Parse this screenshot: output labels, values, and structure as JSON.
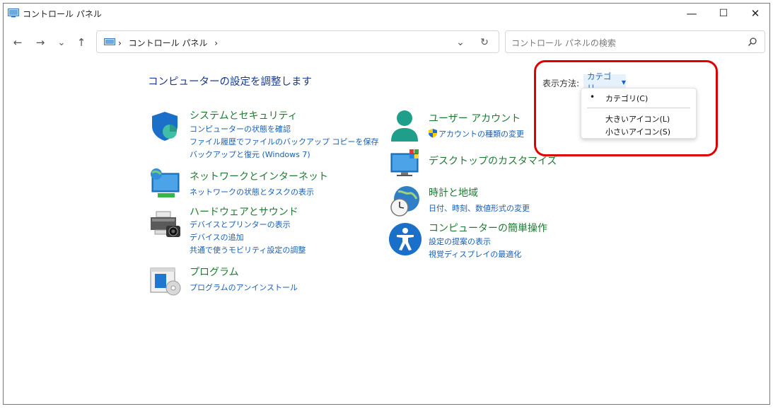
{
  "window": {
    "title": "コントロール パネル",
    "minimize": "—",
    "maximize": "☐",
    "close": "✕"
  },
  "nav": {
    "back": "←",
    "forward": "→",
    "recent": "⌄",
    "up": "↑",
    "breadcrumb_sep1": "›",
    "breadcrumb_item": "コントロール パネル",
    "breadcrumb_sep2": "›",
    "dropdown": "⌄",
    "refresh": "↻",
    "search_placeholder": "コントロール パネルの検索"
  },
  "main": {
    "heading": "コンピューターの設定を調整します",
    "view_label": "表示方法:",
    "view_value": "カテゴリ",
    "view_arrow": "▼"
  },
  "menu": {
    "items": [
      {
        "label": "カテゴリ(C)",
        "selected": true,
        "marker": "•"
      },
      {
        "label": "大きいアイコン(L)",
        "selected": false
      },
      {
        "label": "小さいアイコン(S)",
        "selected": false
      }
    ]
  },
  "left_categories": [
    {
      "title": "システムとセキュリティ",
      "icon": "shield-icon",
      "links": [
        "コンピューターの状態を確認",
        "ファイル履歴でファイルのバックアップ コピーを保存",
        "バックアップと復元 (Windows 7)"
      ]
    },
    {
      "title": "ネットワークとインターネット",
      "icon": "network-icon",
      "links": [
        "ネットワークの状態とタスクの表示"
      ]
    },
    {
      "title": "ハードウェアとサウンド",
      "icon": "printer-icon",
      "links": [
        "デバイスとプリンターの表示",
        "デバイスの追加",
        "共通で使うモビリティ設定の調整"
      ]
    },
    {
      "title": "プログラム",
      "icon": "programs-icon",
      "links": [
        "プログラムのアンインストール"
      ]
    }
  ],
  "right_categories": [
    {
      "title": "ユーザー アカウント",
      "icon": "user-icon",
      "links": [
        "アカウントの種類の変更"
      ]
    },
    {
      "title": "デスクトップのカスタマイズ",
      "icon": "desktop-icon",
      "links": []
    },
    {
      "title": "時計と地域",
      "icon": "clock-globe-icon",
      "links": [
        "日付、時刻、数値形式の変更"
      ]
    },
    {
      "title": "コンピューターの簡単操作",
      "icon": "accessibility-icon",
      "links": [
        "設定の提案の表示",
        "視覚ディスプレイの最適化"
      ]
    }
  ],
  "colors": {
    "category_title": "#1f7a33",
    "link": "#1a5fb4",
    "heading": "#1e3b8a",
    "highlight_box": "#e00000"
  }
}
